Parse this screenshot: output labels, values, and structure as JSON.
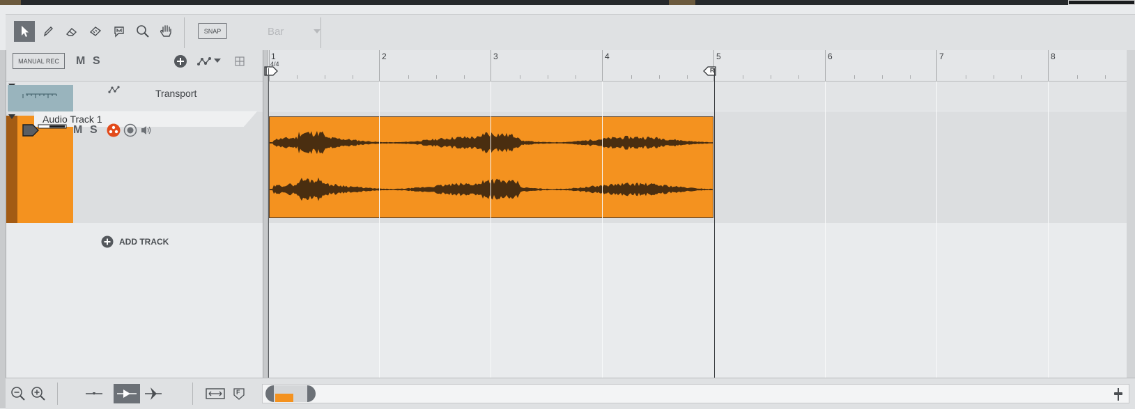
{
  "toolbar": {
    "tools": [
      "select-tool",
      "pencil-tool",
      "eraser-tool",
      "split-tool",
      "marker-tool",
      "zoom-tool",
      "hand-tool"
    ],
    "snap_label": "SNAP",
    "snap_value": "Bar"
  },
  "tracks_header": {
    "manual_rec_label": "MANUAL REC",
    "mute_label": "M",
    "solo_label": "S"
  },
  "ruler": {
    "bars": [
      "1",
      "2",
      "3",
      "4",
      "5",
      "6",
      "7",
      "8"
    ],
    "time_signature": "4/4",
    "return_marker": "R"
  },
  "tracks": {
    "transport": {
      "name": "Transport"
    },
    "audio1": {
      "name": "Audio Track 1",
      "mute_label": "M",
      "solo_label": "S",
      "color": "#f4921f"
    }
  },
  "add_track_label": "ADD TRACK",
  "bottom": {
    "fit_label": "F"
  },
  "colors": {
    "accent": "#f4921f",
    "waveform": "#4a2e10",
    "record": "#e24a1a"
  }
}
